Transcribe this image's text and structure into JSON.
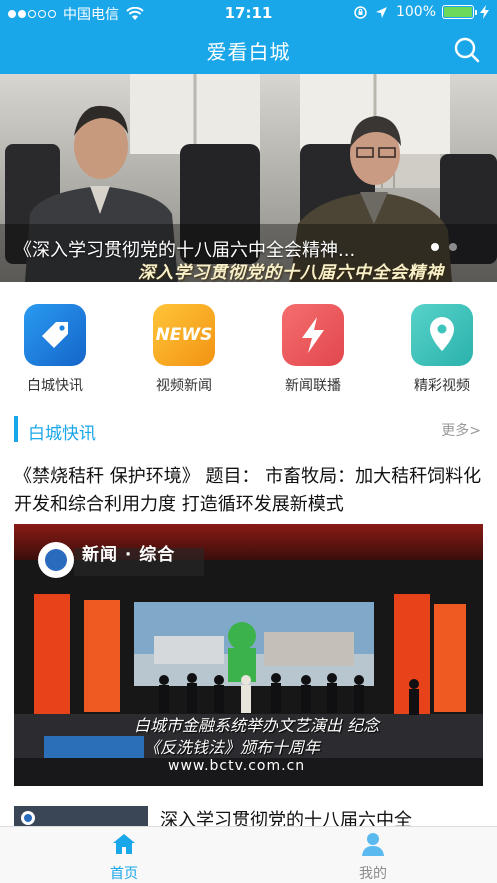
{
  "status_bar": {
    "carrier": "中国电信",
    "time": "17:11",
    "battery": "100%",
    "battery_level": 1.0
  },
  "header": {
    "title": "爱看白城",
    "search_icon": "search-icon"
  },
  "banner": {
    "caption": "《深入学习贯彻党的十八届六中全会精神...",
    "overlay_text": "深入学习贯彻党的十八届六中全会精神",
    "page_count": 2,
    "active_page": 1
  },
  "categories": [
    {
      "label": "白城快讯",
      "icon": "tag-icon",
      "color": "#1f83e0"
    },
    {
      "label": "视频新闻",
      "icon": "news-icon",
      "color": "#f7a81b"
    },
    {
      "label": "新闻联播",
      "icon": "lightning-icon",
      "color": "#ef5a5f"
    },
    {
      "label": "精彩视频",
      "icon": "location-pin-icon",
      "color": "#3fc3bd"
    }
  ],
  "news_logo_text": "NEWS",
  "section": {
    "title": "白城快讯",
    "more_label": "更多>"
  },
  "articles": [
    {
      "title": "《禁烧秸秆 保护环境》 题目： 市畜牧局：加大秸秆饲料化开发和综合利用力度 打造循环发展新模式",
      "image_texts": {
        "channel": "新闻 · 综合",
        "subtitle_1": "白城市金融系统举办文艺演出 纪念",
        "subtitle_2": "《反洗钱法》颁布十周年",
        "url": "www.bctv.com.cn"
      }
    },
    {
      "title": "深入学习贯彻党的十八届六中全"
    }
  ],
  "tabs": [
    {
      "label": "首页",
      "icon": "home-icon",
      "active": true
    },
    {
      "label": "我的",
      "icon": "user-icon",
      "active": false
    }
  ],
  "colors": {
    "accent": "#1aa7ea",
    "tab_active": "#1aa7ea",
    "tab_inactive": "#8c8c8c"
  }
}
